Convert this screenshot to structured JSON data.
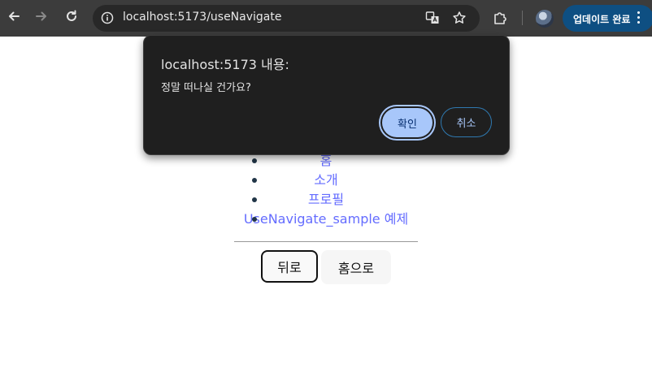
{
  "browser": {
    "url": "localhost:5173/useNavigate",
    "update_button_label": "업데이트 완료"
  },
  "dialog": {
    "title": "localhost:5173 내용:",
    "message": "정말 떠나실 건가요?",
    "confirm_label": "확인",
    "cancel_label": "취소"
  },
  "page": {
    "nav_links": [
      "홈",
      "소개",
      "프로필",
      "UseNavigate_sample 예제"
    ],
    "back_button_label": "뒤로",
    "home_button_label": "홈으로"
  },
  "colors": {
    "link": "#646cff",
    "dialog_bg": "#1f1f1f",
    "confirm_bg": "#a8c7fa",
    "update_bg": "#0e4f82"
  }
}
